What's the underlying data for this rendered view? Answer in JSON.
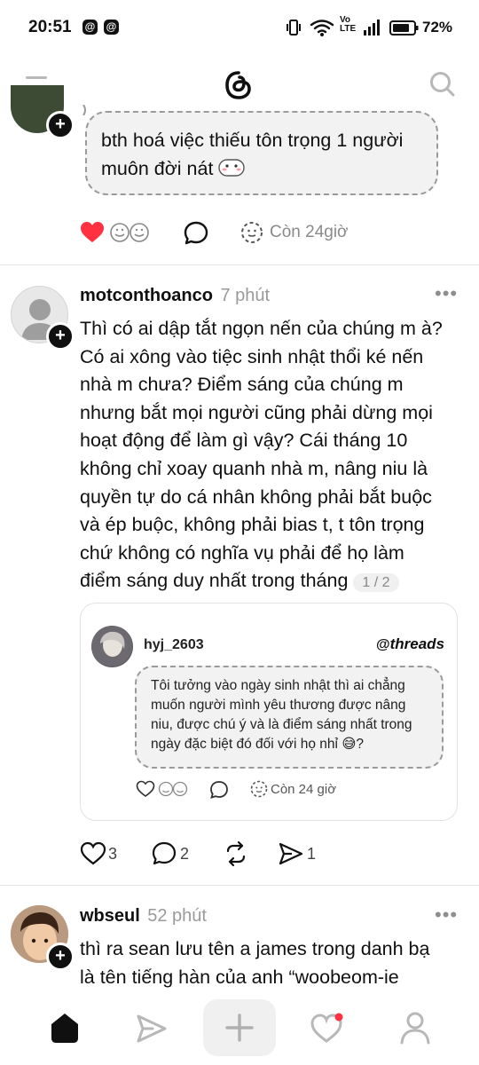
{
  "status_bar": {
    "time": "20:51",
    "app_icons": [
      "threads-icon",
      "threads-icon"
    ],
    "net_label_1": "Vo",
    "net_label_2": "LTE",
    "battery": "72%"
  },
  "header": {
    "logo": "threads-logo"
  },
  "post1": {
    "reply_text": "bth hoá việc thiếu tôn trọng 1 người muôn đời nát",
    "expires": "Còn 24giờ",
    "liked": true,
    "like_color": "#ff3040"
  },
  "post2": {
    "username": "motconthoanco",
    "time": "7 phút",
    "lines": [
      "Thì có ai dập tắt ngọn nến của chúng m à?",
      "Có ai xông vào tiệc sinh nhật thổi ké nến",
      "nhà m chưa? Điểm sáng của chúng m",
      "nhưng bắt mọi người cũng phải dừng mọi",
      "hoạt động để làm gì vậy? Cái tháng 10",
      "không chỉ xoay quanh nhà m, nâng niu là",
      "quyền tự do cá nhân không phải bắt buộc",
      "và ép buộc, không phải bias t, t tôn trọng",
      "chứ không có nghĩa vụ phải để họ làm",
      "điểm sáng duy nhất trong tháng"
    ],
    "page_indicator": "1 / 2",
    "quote": {
      "username": "hyj_2603",
      "brand": "threads",
      "lines": [
        "Tôi tưởng vào ngày sinh nhật thì ai chẳng",
        "muốn người mình yêu thương được nâng",
        "niu, được chú ý và là điểm sáng nhất trong",
        "ngày đặc biệt đó đối với họ nhỉ 😅?"
      ],
      "expires": "Còn 24 giờ"
    },
    "likes": "3",
    "replies": "2",
    "shares": "1"
  },
  "post3": {
    "username": "wbseul",
    "time": "52 phút",
    "lines": [
      "thì ra sean lưu tên a james trong danh bạ",
      "là tên tiếng hàn của anh “woobeom-ie"
    ]
  },
  "bottom_nav": {
    "items": [
      "home-icon",
      "send-icon",
      "plus-icon",
      "heart-icon",
      "profile-icon"
    ],
    "notification_dot_color": "#ff3040"
  }
}
